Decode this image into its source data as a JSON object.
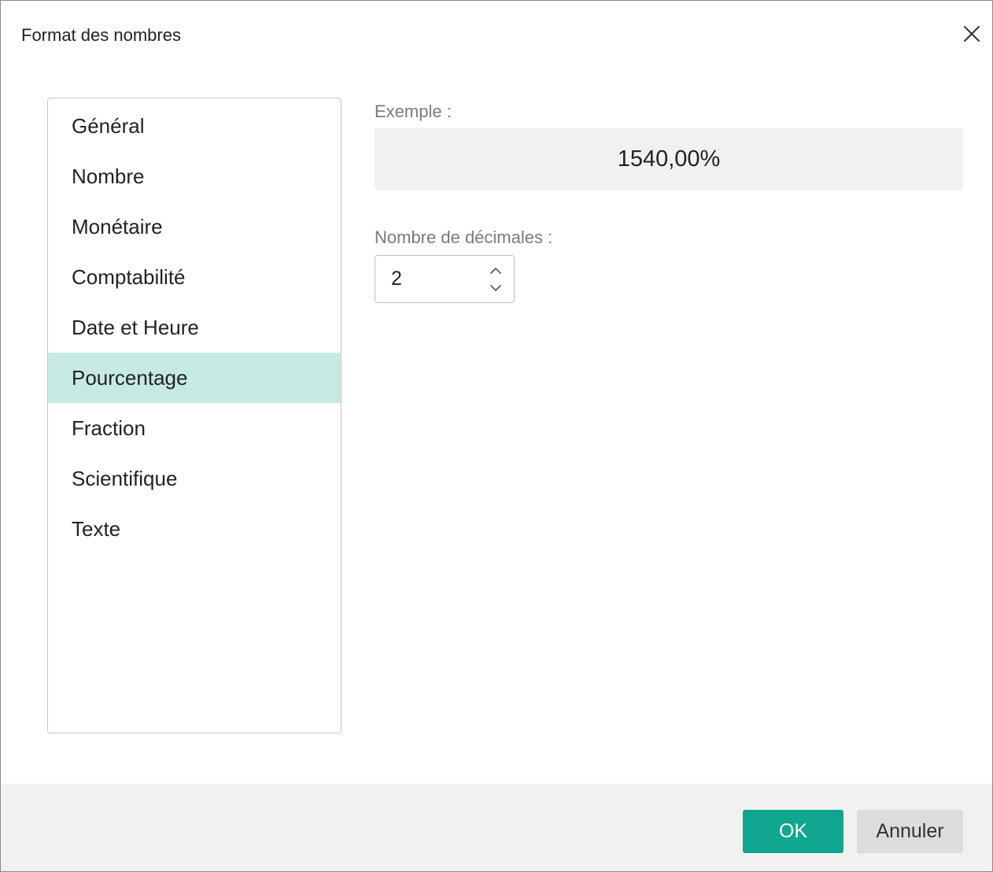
{
  "dialog": {
    "title": "Format des nombres",
    "close_icon": "close-icon"
  },
  "categories": [
    {
      "label": "Général"
    },
    {
      "label": "Nombre"
    },
    {
      "label": "Monétaire"
    },
    {
      "label": "Comptabilité"
    },
    {
      "label": "Date et Heure"
    },
    {
      "label": "Pourcentage",
      "selected": true
    },
    {
      "label": "Fraction"
    },
    {
      "label": "Scientifique"
    },
    {
      "label": "Texte"
    }
  ],
  "example": {
    "label": "Exemple :",
    "value": "1540,00%"
  },
  "decimals": {
    "label": "Nombre de décimales :",
    "value": "2",
    "up_icon": "chevron-up-icon",
    "down_icon": "chevron-down-icon"
  },
  "footer": {
    "ok_label": "OK",
    "cancel_label": "Annuler"
  },
  "colors": {
    "selected_bg": "#c6e9e3",
    "primary": "#10a58e",
    "secondary": "#dcdcdc"
  }
}
